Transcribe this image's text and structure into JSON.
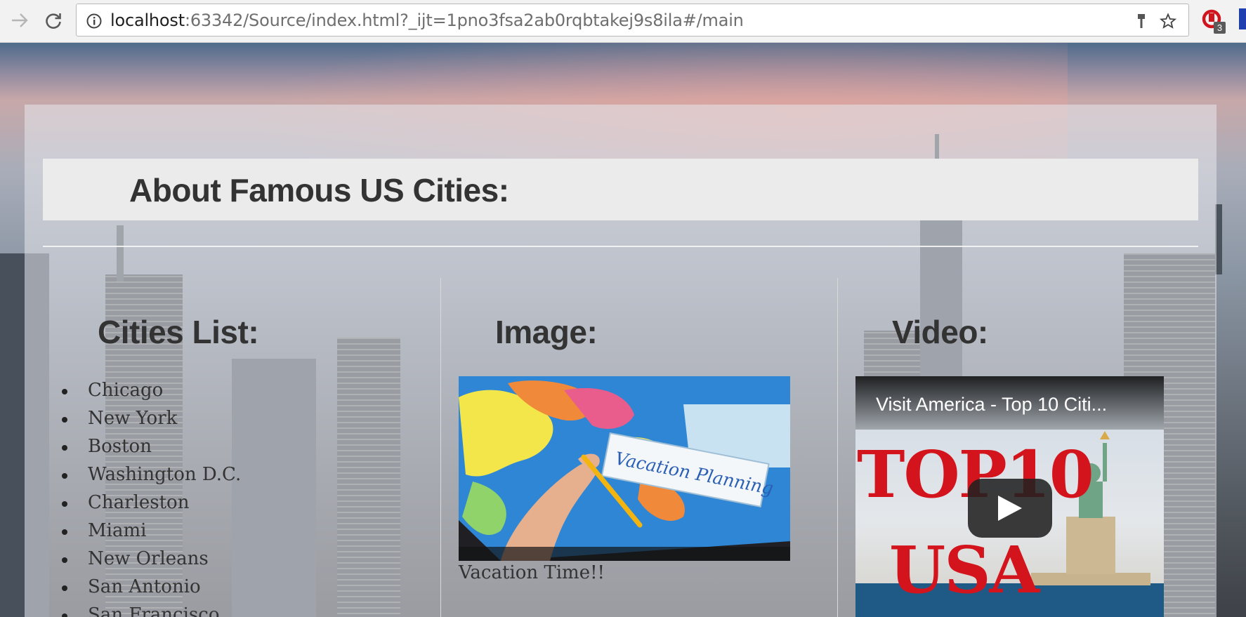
{
  "browser": {
    "url_host": "localhost",
    "url_path": ":63342/Source/index.html?_ijt=1pno3fsa2ab0rqbtakej9s8ila#/main",
    "extension_badge": "3",
    "icons": [
      "back-icon",
      "reload-icon",
      "info-icon",
      "key-icon",
      "star-icon",
      "extension-icon"
    ]
  },
  "page": {
    "title": "About Famous US Cities:",
    "columns": {
      "cities_title": "Cities List:",
      "image_title": "Image:",
      "video_title": "Video:"
    },
    "cities": [
      "Chicago",
      "New York",
      "Boston",
      "Washington D.C.",
      "Charleston",
      "Miami",
      "New Orleans",
      "San Antonio",
      "San Francisco"
    ],
    "image": {
      "card_text": "Vacation Planning",
      "caption": "Vacation Time!!"
    },
    "video": {
      "title": "Visit America - Top 10 Citi...",
      "thumb_line1": "TOP10",
      "thumb_line2": "USA"
    }
  },
  "colors": {
    "heading_text": "#333333",
    "video_red": "#d4141c",
    "header_band": "#ebebeb"
  }
}
